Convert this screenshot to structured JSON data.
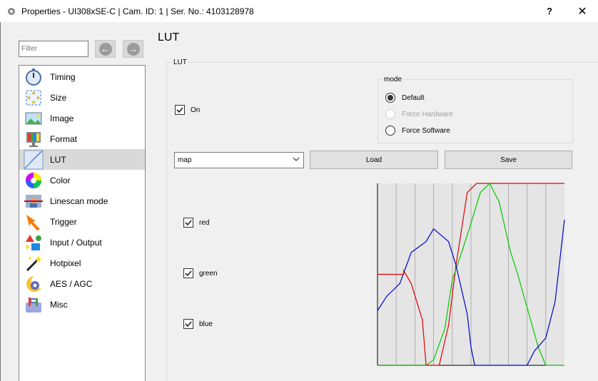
{
  "window": {
    "title": "Properties - UI308xSE-C | Cam. ID: 1 | Ser. No.: 4103128978",
    "help_label": "?",
    "close_label": "✕"
  },
  "filter": {
    "placeholder": "Filter"
  },
  "nav": {
    "back": "←",
    "forward": "→"
  },
  "tree": {
    "items": [
      {
        "label": "Timing",
        "icon": "stopwatch-icon"
      },
      {
        "label": "Size",
        "icon": "resize-icon"
      },
      {
        "label": "Image",
        "icon": "image-icon"
      },
      {
        "label": "Format",
        "icon": "monitor-icon"
      },
      {
        "label": "LUT",
        "icon": "lut-curve-icon",
        "selected": true
      },
      {
        "label": "Color",
        "icon": "color-wheel-icon"
      },
      {
        "label": "Linescan mode",
        "icon": "linescan-icon"
      },
      {
        "label": "Trigger",
        "icon": "trigger-arrow-icon"
      },
      {
        "label": "Input / Output",
        "icon": "io-shapes-icon"
      },
      {
        "label": "Hotpixel",
        "icon": "magic-wand-icon"
      },
      {
        "label": "AES / AGC",
        "icon": "gear-moon-icon"
      },
      {
        "label": "Misc",
        "icon": "toolbox-icon"
      }
    ]
  },
  "page": {
    "title": "LUT"
  },
  "lut_group": {
    "label": "LUT",
    "on": {
      "label": "On",
      "checked": true
    },
    "mode": {
      "label": "mode",
      "options": [
        {
          "label": "Default",
          "selected": true,
          "enabled": true
        },
        {
          "label": "Force Hardware",
          "selected": false,
          "enabled": false
        },
        {
          "label": "Force Software",
          "selected": false,
          "enabled": true
        }
      ]
    },
    "preset": {
      "value": "map"
    },
    "load_label": "Load",
    "save_label": "Save",
    "channels": {
      "red": {
        "label": "red",
        "checked": true
      },
      "green": {
        "label": "green",
        "checked": true
      },
      "blue": {
        "label": "blue",
        "checked": true
      }
    }
  },
  "colors": {
    "red": "#e00000",
    "green": "#00c800",
    "blue": "#0000cc",
    "grid_bg": "#e5e5e5"
  },
  "chart_data": {
    "type": "line",
    "xlim": [
      0,
      1
    ],
    "ylim": [
      0,
      1
    ],
    "grid": true,
    "series": [
      {
        "color": "#e00000",
        "x": [
          0,
          0.15,
          0.17,
          0.26,
          0.33,
          0.38,
          0.42,
          0.48,
          0.53,
          0.58,
          0.6,
          0.72,
          1.0
        ],
        "y": [
          0,
          0,
          0,
          0,
          0,
          0.22,
          0.55,
          0.95,
          1.0,
          1.0,
          1.0,
          1.0,
          1.0
        ]
      },
      {
        "color": "#00c800",
        "x": [
          0,
          0.25,
          0.26,
          0.3,
          0.36,
          0.4,
          0.45,
          0.5,
          0.55,
          0.6,
          0.65,
          0.71,
          0.75,
          0.86,
          0.9,
          1.0
        ],
        "y": [
          0,
          0,
          0,
          0.03,
          0.2,
          0.47,
          0.62,
          0.78,
          0.95,
          1.0,
          0.9,
          0.63,
          0.5,
          0.1,
          0.0,
          0.0
        ]
      },
      {
        "color": "#0000cc",
        "x": [
          0,
          0.05,
          0.12,
          0.18,
          0.26,
          0.3,
          0.38,
          0.42,
          0.48,
          0.5,
          0.52,
          0.62,
          0.65,
          0.8,
          0.84,
          0.9,
          0.95,
          1.0
        ],
        "y": [
          0.3,
          0.38,
          0.45,
          0.62,
          0.68,
          0.75,
          0.68,
          0.55,
          0.28,
          0.1,
          0.0,
          0.0,
          0.0,
          0.0,
          0.08,
          0.15,
          0.35,
          0.8
        ]
      },
      {
        "color": "#e00000",
        "x": [
          0,
          0.14,
          0.14,
          0.18,
          0.24,
          0.26
        ],
        "y": [
          0.5,
          0.5,
          0.52,
          0.45,
          0.25,
          0.0
        ]
      }
    ]
  }
}
